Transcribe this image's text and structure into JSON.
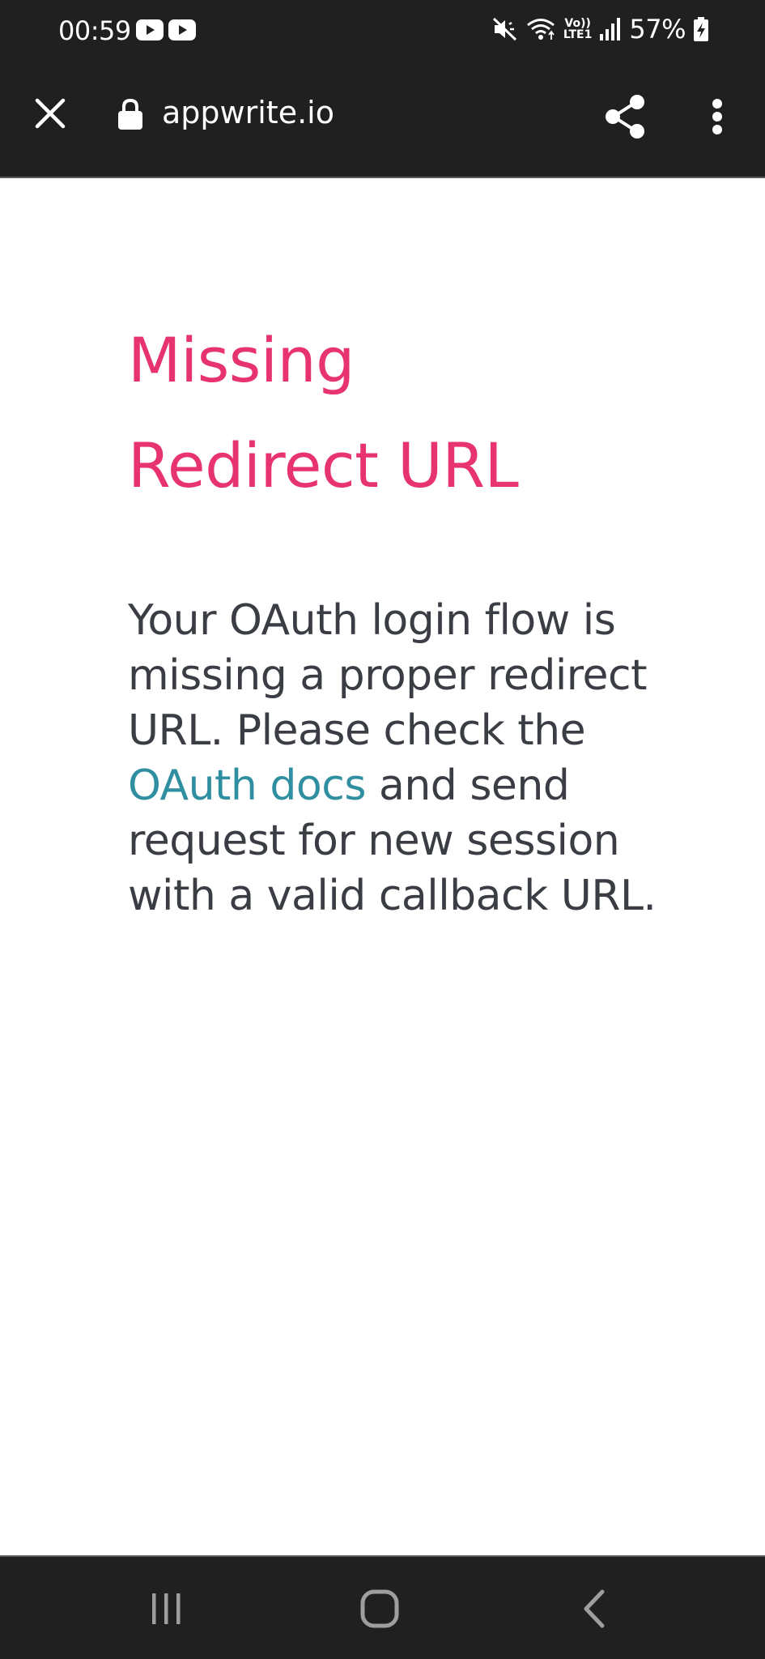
{
  "status_bar": {
    "time": "00:59",
    "battery_percent": "57%",
    "notification_icons": [
      "youtube-icon",
      "youtube-icon"
    ],
    "system_icons": [
      "mute-icon",
      "wifi-icon",
      "volte-lte-icon",
      "signal-icon",
      "battery-charging-icon"
    ],
    "volte_label_top": "Vo))",
    "volte_label_bottom": "LTE1"
  },
  "toolbar": {
    "url": "appwrite.io"
  },
  "content": {
    "title_line1": "Missing",
    "title_line2": "Redirect URL",
    "text_before_link": "Your OAuth login flow is missing a proper redirect URL. Please check the ",
    "link_text": "OAuth docs",
    "text_after_link": " and send request for new session with a valid callback URL."
  },
  "colors": {
    "title": "#e7336f",
    "link": "#2f8fa0",
    "body_text": "#3b3d45",
    "bars": "#202020"
  }
}
